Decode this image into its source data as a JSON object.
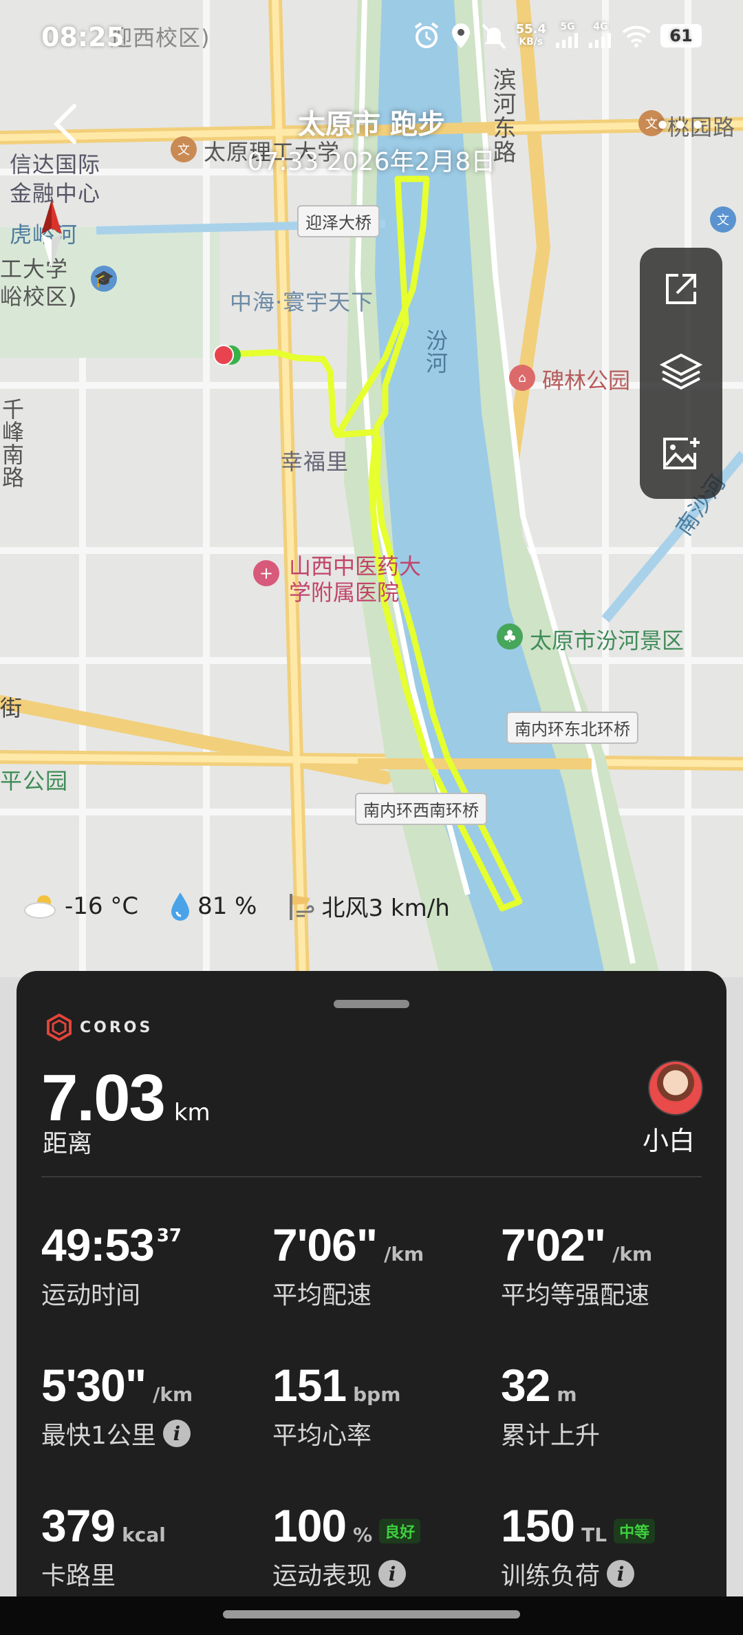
{
  "status_bar": {
    "time": "08:25",
    "net_speed": "55.4",
    "net_unit": "KB/s",
    "sim1": "5G",
    "sim2": "4G",
    "battery": "61"
  },
  "header": {
    "title": "太原市 跑步",
    "subtitle": "07:33 2026年2月8日",
    "more": "•••"
  },
  "map": {
    "labels": {
      "top_cut": "迎西校区)",
      "binhe": "滨河东路",
      "taoyuan": "桃园路",
      "taiyuan_univ": "太原理工大学",
      "xinda": "信达国际",
      "xinda2": "金融中心",
      "huhe": "虎峪河",
      "ligong": "工大学",
      "ligong2": "峪校区)",
      "zhonghai": "中海·寰宇天下",
      "fenhe": "汾河",
      "beilin": "碑林公园",
      "qianfeng": "千峰南路",
      "xingfuli": "幸福里",
      "hospital": "山西中医药大",
      "hospital2": "学附属医院",
      "nansha": "南沙河",
      "scenic": "太原市汾河景区",
      "jie": "街",
      "pinggongyuan": "平公园",
      "bridge_yingze": "迎泽大桥",
      "bridge_ne": "南内环东北环桥",
      "bridge_sw": "南内环西南环桥"
    },
    "route_color": "#e6ff2e"
  },
  "weather": {
    "temp": "-16 °C",
    "humidity": "81 %",
    "wind": "北风3 km/h"
  },
  "card": {
    "brand": "COROS",
    "distance_value": "7.03",
    "distance_unit": "km",
    "distance_label": "距离",
    "user_name": "小白",
    "stats": [
      {
        "value": "49:53",
        "sup": "37",
        "unit": "",
        "label": "运动时间"
      },
      {
        "value": "7'06\"",
        "unit": "/km",
        "label": "平均配速"
      },
      {
        "value": "7'02\"",
        "unit": "/km",
        "label": "平均等强配速"
      },
      {
        "value": "5'30\"",
        "unit": "/km",
        "label": "最快1公里"
      },
      {
        "value": "151",
        "unit": "bpm",
        "label": "平均心率"
      },
      {
        "value": "32",
        "unit": "m",
        "label": "累计上升"
      },
      {
        "value": "379",
        "unit": "kcal",
        "label": "卡路里"
      },
      {
        "value": "100",
        "unit": "%",
        "badge": "良好",
        "label": "运动表现"
      },
      {
        "value": "150",
        "unit": "TL",
        "badge": "中等",
        "label": "训练负荷"
      }
    ]
  }
}
